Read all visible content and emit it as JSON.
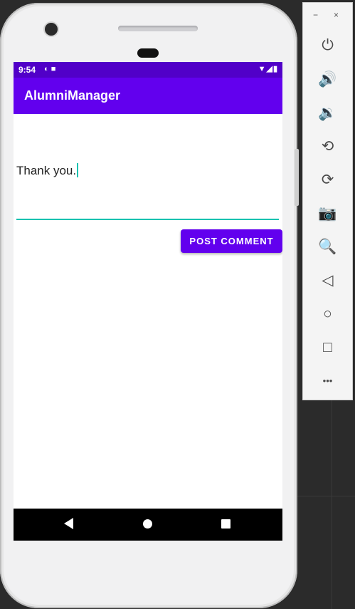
{
  "status_bar": {
    "time": "9:54",
    "left_icons": "◐ ■",
    "right_icons": "▼◢▮"
  },
  "app_bar": {
    "title": "AlumniManager"
  },
  "comment": {
    "value": "Thank you."
  },
  "post_button": {
    "label": "POST COMMENT"
  },
  "colors": {
    "primary": "#6200ee",
    "primary_dark": "#5100c8",
    "accent": "#03c2b0"
  },
  "toolbar": {
    "minimize": "−",
    "close": "×",
    "icons": [
      {
        "name": "power-icon",
        "glyph": "⏻"
      },
      {
        "name": "volume-up-icon",
        "glyph": "🔊"
      },
      {
        "name": "volume-down-icon",
        "glyph": "🔉"
      },
      {
        "name": "rotate-left-icon",
        "glyph": "⟲"
      },
      {
        "name": "rotate-right-icon",
        "glyph": "⟳"
      },
      {
        "name": "camera-icon",
        "glyph": "📷"
      },
      {
        "name": "zoom-icon",
        "glyph": "🔍"
      },
      {
        "name": "back-icon",
        "glyph": "◁"
      },
      {
        "name": "home-icon",
        "glyph": "○"
      },
      {
        "name": "overview-icon",
        "glyph": "□"
      },
      {
        "name": "more-icon",
        "glyph": "•••"
      }
    ]
  }
}
